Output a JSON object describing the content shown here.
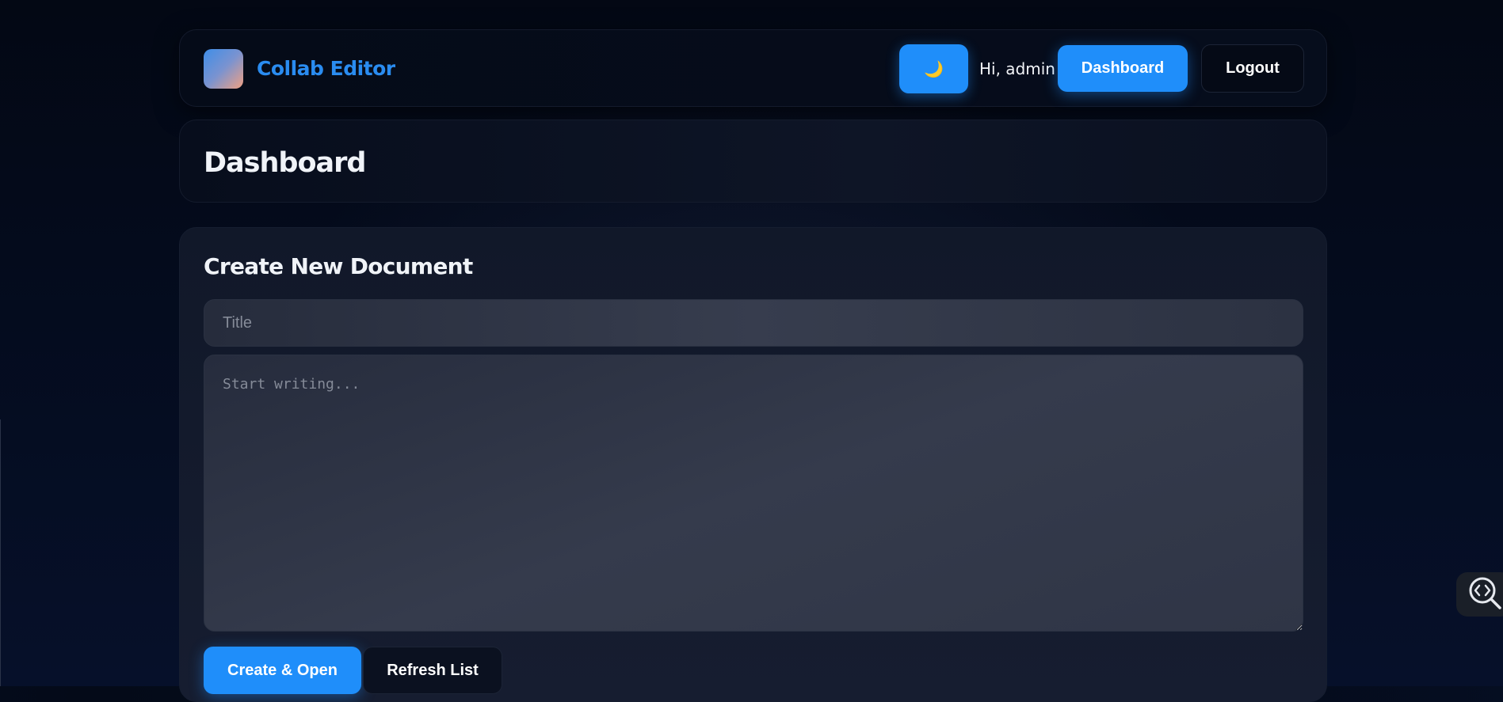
{
  "header": {
    "brand": "Collab Editor",
    "theme_icon": "moon-icon",
    "theme_glyph": "🌙",
    "greeting": "Hi, admin",
    "dashboard_label": "Dashboard",
    "logout_label": "Logout"
  },
  "page": {
    "title": "Dashboard"
  },
  "create": {
    "section_title": "Create New Document",
    "title_placeholder": "Title",
    "title_value": "",
    "body_placeholder": "Start writing...",
    "body_value": "",
    "create_label": "Create & Open",
    "refresh_label": "Refresh List"
  },
  "colors": {
    "accent": "#1f8efa",
    "brand_text": "#2a8cf0",
    "background": "#040a18"
  }
}
